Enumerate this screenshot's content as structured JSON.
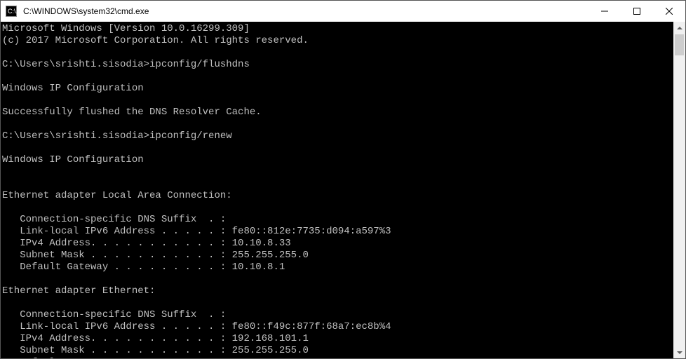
{
  "titlebar": {
    "icon_text": "C:\\.",
    "title": "C:\\WINDOWS\\system32\\cmd.exe"
  },
  "terminal": {
    "lines": [
      "Microsoft Windows [Version 10.0.16299.309]",
      "(c) 2017 Microsoft Corporation. All rights reserved.",
      "",
      "C:\\Users\\srishti.sisodia>ipconfig/flushdns",
      "",
      "Windows IP Configuration",
      "",
      "Successfully flushed the DNS Resolver Cache.",
      "",
      "C:\\Users\\srishti.sisodia>ipconfig/renew",
      "",
      "Windows IP Configuration",
      "",
      "",
      "Ethernet adapter Local Area Connection:",
      "",
      "   Connection-specific DNS Suffix  . :",
      "   Link-local IPv6 Address . . . . . : fe80::812e:7735:d094:a597%3",
      "   IPv4 Address. . . . . . . . . . . : 10.10.8.33",
      "   Subnet Mask . . . . . . . . . . . : 255.255.255.0",
      "   Default Gateway . . . . . . . . . : 10.10.8.1",
      "",
      "Ethernet adapter Ethernet:",
      "",
      "   Connection-specific DNS Suffix  . :",
      "   Link-local IPv6 Address . . . . . : fe80::f49c:877f:68a7:ec8b%4",
      "   IPv4 Address. . . . . . . . . . . : 192.168.101.1",
      "   Subnet Mask . . . . . . . . . . . : 255.255.255.0",
      "   Default Gateway . . . . . . . . . :"
    ]
  }
}
